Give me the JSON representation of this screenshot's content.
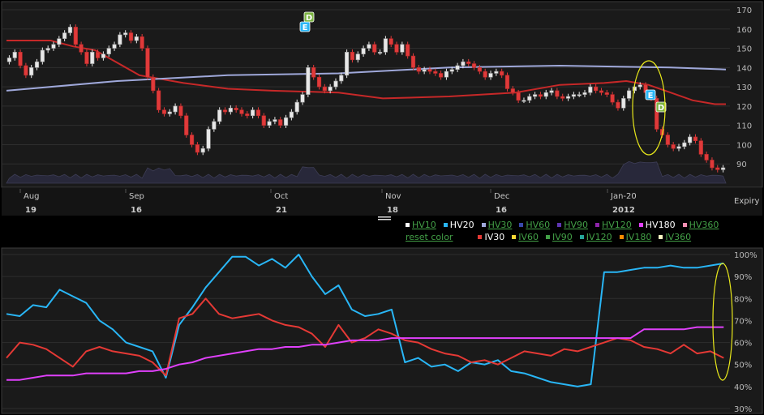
{
  "chart_data": [
    {
      "type": "candlestick",
      "title": "",
      "xlabel": "",
      "ylabel": "",
      "ylim": [
        80,
        170
      ],
      "yticks": [
        90,
        100,
        110,
        120,
        130,
        140,
        150,
        160,
        170
      ],
      "x_month_labels": [
        {
          "month": "Aug",
          "day": "19"
        },
        {
          "month": "Sep",
          "day": "16"
        },
        {
          "month": "Oct",
          "day": "21"
        },
        {
          "month": "Nov",
          "day": "18"
        },
        {
          "month": "Dec",
          "day": "16"
        },
        {
          "month": "Jan-20",
          "day": "2012"
        }
      ],
      "expiry_label": "Expiry",
      "close_prices": [
        145,
        148,
        141,
        136,
        140,
        143,
        149,
        150,
        152,
        155,
        158,
        161,
        152,
        148,
        142,
        148,
        145,
        147,
        150,
        152,
        157,
        158,
        154,
        156,
        150,
        135,
        128,
        118,
        116,
        117,
        120,
        115,
        105,
        100,
        96,
        98,
        108,
        112,
        118,
        117,
        119,
        118,
        116,
        115,
        118,
        115,
        110,
        112,
        113,
        110,
        114,
        117,
        122,
        126,
        140,
        135,
        130,
        128,
        130,
        133,
        136,
        148,
        144,
        147,
        150,
        152,
        148,
        148,
        155,
        152,
        148,
        152,
        146,
        140,
        138,
        139,
        138,
        137,
        135,
        138,
        139,
        141,
        143,
        142,
        140,
        138,
        135,
        137,
        138,
        136,
        129,
        127,
        123,
        123,
        125,
        126,
        125,
        127,
        128,
        125,
        124,
        125,
        126,
        126,
        127,
        130,
        128,
        127,
        126,
        122,
        119,
        124,
        128,
        130,
        131,
        127,
        124,
        108,
        105,
        100,
        98,
        99,
        101,
        104,
        102,
        95,
        92,
        88,
        87,
        88
      ],
      "moving_averages": [
        {
          "name": "",
          "color": "#c62828",
          "values": [
            [
              0,
              154
            ],
            [
              20,
              154
            ],
            [
              30,
              151
            ],
            [
              40,
              149
            ],
            [
              60,
              136
            ],
            [
              80,
              132
            ],
            [
              100,
              129
            ],
            [
              120,
              128
            ],
            [
              150,
              127
            ],
            [
              170,
              124
            ],
            [
              200,
              125
            ],
            [
              230,
              127
            ],
            [
              250,
              131
            ],
            [
              270,
              132
            ],
            [
              280,
              133
            ],
            [
              290,
              131
            ],
            [
              300,
              127
            ],
            [
              310,
              123
            ],
            [
              315,
              122
            ],
            [
              320,
              121
            ],
            [
              325,
              121
            ]
          ]
        },
        {
          "name": "",
          "color": "#9fa8da",
          "values": [
            [
              0,
              128
            ],
            [
              50,
              133
            ],
            [
              100,
              136
            ],
            [
              150,
              137
            ],
            [
              200,
              140
            ],
            [
              250,
              141
            ],
            [
              300,
              140
            ],
            [
              325,
              139
            ]
          ]
        }
      ],
      "events": [
        {
          "label": "E",
          "color": "#29b6f6"
        },
        {
          "label": "D",
          "color": "#7cb342"
        },
        {
          "label": "E",
          "color": "#29b6f6"
        },
        {
          "label": "D",
          "color": "#7cb342"
        }
      ]
    },
    {
      "type": "line",
      "title": "",
      "xlabel": "",
      "ylabel": "",
      "ylim": [
        30,
        100
      ],
      "yticks": [
        "30%",
        "40%",
        "50%",
        "60%",
        "70%",
        "80%",
        "90%",
        "100%"
      ],
      "x": [
        0,
        6,
        12,
        18,
        24,
        30,
        36,
        42,
        48,
        54,
        60,
        66,
        72,
        78,
        84,
        90,
        96,
        102,
        108,
        114,
        120,
        126,
        132,
        138,
        144,
        150,
        156,
        162,
        168,
        174,
        180,
        186,
        192,
        198,
        204,
        210,
        216,
        222,
        228,
        234,
        240,
        246,
        252,
        258,
        264,
        270,
        276,
        282,
        288,
        294,
        300,
        306,
        312,
        318,
        324
      ],
      "series": [
        {
          "name": "HV20",
          "color": "#29b6f6",
          "values": [
            73,
            72,
            77,
            76,
            84,
            81,
            78,
            70,
            66,
            60,
            58,
            56,
            44,
            68,
            76,
            85,
            92,
            99,
            99,
            95,
            98,
            94,
            100,
            90,
            82,
            86,
            75,
            72,
            73,
            75,
            51,
            53,
            49,
            50,
            47,
            51,
            50,
            52,
            47,
            46,
            44,
            42,
            41,
            40,
            41,
            92,
            92,
            93,
            94,
            94,
            95,
            94,
            94,
            95,
            96
          ]
        },
        {
          "name": "IV30",
          "color": "#e53935",
          "values": [
            53,
            60,
            59,
            57,
            53,
            49,
            56,
            58,
            56,
            55,
            54,
            51,
            45,
            71,
            73,
            80,
            73,
            71,
            72,
            73,
            70,
            68,
            67,
            64,
            58,
            68,
            60,
            62,
            66,
            64,
            61,
            60,
            57,
            55,
            54,
            51,
            52,
            50,
            53,
            56,
            55,
            54,
            57,
            56,
            58,
            60,
            62,
            61,
            58,
            57,
            55,
            59,
            55,
            56,
            53
          ]
        },
        {
          "name": "HV180",
          "color": "#e040fb",
          "values": [
            43,
            43,
            44,
            45,
            45,
            45,
            46,
            46,
            46,
            46,
            47,
            47,
            48,
            50,
            51,
            53,
            54,
            55,
            56,
            57,
            57,
            58,
            58,
            59,
            59,
            60,
            61,
            61,
            61,
            62,
            62,
            62,
            62,
            62,
            62,
            62,
            62,
            62,
            62,
            62,
            62,
            62,
            62,
            62,
            62,
            62,
            62,
            62,
            66,
            66,
            66,
            66,
            67,
            67,
            67
          ]
        }
      ]
    }
  ],
  "legend": {
    "row1": [
      {
        "label": "HV10",
        "active": false,
        "color": "#ffffff"
      },
      {
        "label": "HV20",
        "active": true,
        "color": "#29b6f6"
      },
      {
        "label": "HV30",
        "active": false,
        "color": "#9fa8da"
      },
      {
        "label": "HV60",
        "active": false,
        "color": "#3949ab"
      },
      {
        "label": "HV90",
        "active": false,
        "color": "#5e35b1"
      },
      {
        "label": "HV120",
        "active": false,
        "color": "#8e24aa"
      },
      {
        "label": "HV180",
        "active": true,
        "color": "#e040fb"
      },
      {
        "label": "HV360",
        "active": false,
        "color": "#f48fb1"
      }
    ],
    "reset_label": "reset color",
    "row2": [
      {
        "label": "IV30",
        "active": true,
        "color": "#e53935"
      },
      {
        "label": "IV60",
        "active": false,
        "color": "#fdd835"
      },
      {
        "label": "IV90",
        "active": false,
        "color": "#43a047"
      },
      {
        "label": "IV120",
        "active": false,
        "color": "#26a69a"
      },
      {
        "label": "IV180",
        "active": false,
        "color": "#fb8c00"
      },
      {
        "label": "IV360",
        "active": false,
        "color": "#fff9c4"
      }
    ]
  }
}
